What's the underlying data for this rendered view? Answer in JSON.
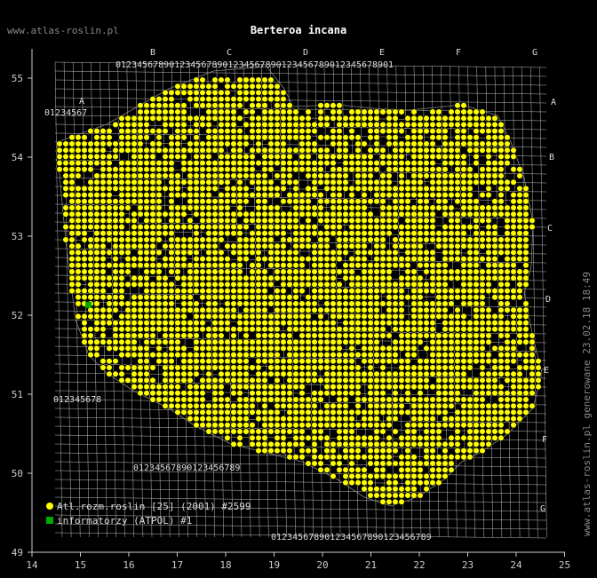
{
  "header": {
    "site": "www.atlas-roslin.pl",
    "title": "Berteroa incana"
  },
  "side_note": "www.atlas-roslin.pl generowane 23.02.18 18:49",
  "legend": [
    {
      "label": "Atl.rozm.roslin [25] (2001) #2599",
      "color": "#ffff00",
      "shape": "circle"
    },
    {
      "label": "informatorzy (ATPOL) #1",
      "color": "#00aa00",
      "shape": "square"
    }
  ],
  "axes": {
    "x_ticks": [
      "14",
      "15",
      "16",
      "17",
      "18",
      "19",
      "20",
      "21",
      "22",
      "23",
      "24",
      "25"
    ],
    "y_ticks": [
      "55",
      "54",
      "53",
      "52",
      "51",
      "50",
      "49"
    ]
  },
  "atpol": {
    "column_letters": [
      "A",
      "B",
      "C",
      "D",
      "E",
      "F",
      "G"
    ],
    "row_letters": [
      "A",
      "B",
      "C",
      "D",
      "E",
      "F",
      "G"
    ],
    "digits": "0123456789"
  },
  "colors": {
    "background": "#000000",
    "grid": "#bbbbbb",
    "occurrence": "#ffff00",
    "informator": "#00aa00",
    "axis": "#cccccc"
  }
}
